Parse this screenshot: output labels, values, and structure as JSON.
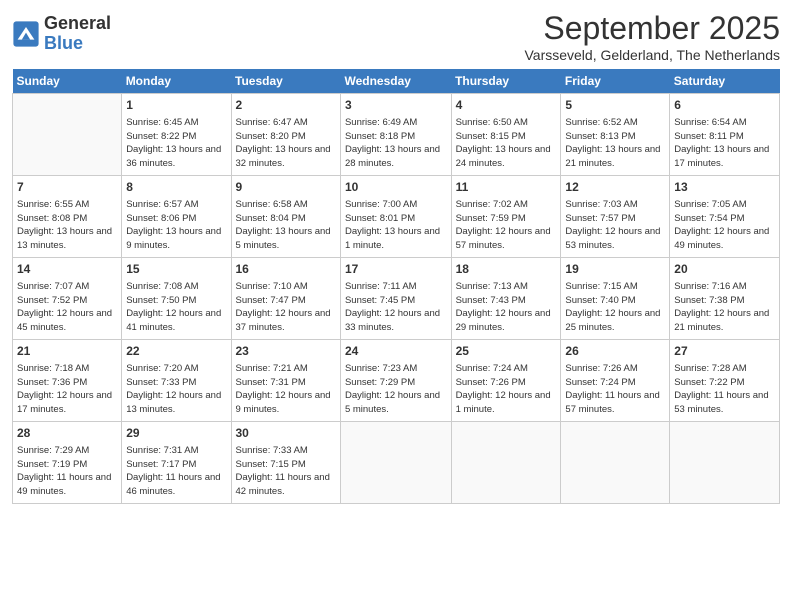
{
  "logo": {
    "general": "General",
    "blue": "Blue"
  },
  "title": "September 2025",
  "subtitle": "Varsseveld, Gelderland, The Netherlands",
  "days_header": [
    "Sunday",
    "Monday",
    "Tuesday",
    "Wednesday",
    "Thursday",
    "Friday",
    "Saturday"
  ],
  "weeks": [
    [
      {
        "day": "",
        "info": ""
      },
      {
        "day": "1",
        "info": "Sunrise: 6:45 AM\nSunset: 8:22 PM\nDaylight: 13 hours\nand 36 minutes."
      },
      {
        "day": "2",
        "info": "Sunrise: 6:47 AM\nSunset: 8:20 PM\nDaylight: 13 hours\nand 32 minutes."
      },
      {
        "day": "3",
        "info": "Sunrise: 6:49 AM\nSunset: 8:18 PM\nDaylight: 13 hours\nand 28 minutes."
      },
      {
        "day": "4",
        "info": "Sunrise: 6:50 AM\nSunset: 8:15 PM\nDaylight: 13 hours\nand 24 minutes."
      },
      {
        "day": "5",
        "info": "Sunrise: 6:52 AM\nSunset: 8:13 PM\nDaylight: 13 hours\nand 21 minutes."
      },
      {
        "day": "6",
        "info": "Sunrise: 6:54 AM\nSunset: 8:11 PM\nDaylight: 13 hours\nand 17 minutes."
      }
    ],
    [
      {
        "day": "7",
        "info": "Sunrise: 6:55 AM\nSunset: 8:08 PM\nDaylight: 13 hours\nand 13 minutes."
      },
      {
        "day": "8",
        "info": "Sunrise: 6:57 AM\nSunset: 8:06 PM\nDaylight: 13 hours\nand 9 minutes."
      },
      {
        "day": "9",
        "info": "Sunrise: 6:58 AM\nSunset: 8:04 PM\nDaylight: 13 hours\nand 5 minutes."
      },
      {
        "day": "10",
        "info": "Sunrise: 7:00 AM\nSunset: 8:01 PM\nDaylight: 13 hours\nand 1 minute."
      },
      {
        "day": "11",
        "info": "Sunrise: 7:02 AM\nSunset: 7:59 PM\nDaylight: 12 hours\nand 57 minutes."
      },
      {
        "day": "12",
        "info": "Sunrise: 7:03 AM\nSunset: 7:57 PM\nDaylight: 12 hours\nand 53 minutes."
      },
      {
        "day": "13",
        "info": "Sunrise: 7:05 AM\nSunset: 7:54 PM\nDaylight: 12 hours\nand 49 minutes."
      }
    ],
    [
      {
        "day": "14",
        "info": "Sunrise: 7:07 AM\nSunset: 7:52 PM\nDaylight: 12 hours\nand 45 minutes."
      },
      {
        "day": "15",
        "info": "Sunrise: 7:08 AM\nSunset: 7:50 PM\nDaylight: 12 hours\nand 41 minutes."
      },
      {
        "day": "16",
        "info": "Sunrise: 7:10 AM\nSunset: 7:47 PM\nDaylight: 12 hours\nand 37 minutes."
      },
      {
        "day": "17",
        "info": "Sunrise: 7:11 AM\nSunset: 7:45 PM\nDaylight: 12 hours\nand 33 minutes."
      },
      {
        "day": "18",
        "info": "Sunrise: 7:13 AM\nSunset: 7:43 PM\nDaylight: 12 hours\nand 29 minutes."
      },
      {
        "day": "19",
        "info": "Sunrise: 7:15 AM\nSunset: 7:40 PM\nDaylight: 12 hours\nand 25 minutes."
      },
      {
        "day": "20",
        "info": "Sunrise: 7:16 AM\nSunset: 7:38 PM\nDaylight: 12 hours\nand 21 minutes."
      }
    ],
    [
      {
        "day": "21",
        "info": "Sunrise: 7:18 AM\nSunset: 7:36 PM\nDaylight: 12 hours\nand 17 minutes."
      },
      {
        "day": "22",
        "info": "Sunrise: 7:20 AM\nSunset: 7:33 PM\nDaylight: 12 hours\nand 13 minutes."
      },
      {
        "day": "23",
        "info": "Sunrise: 7:21 AM\nSunset: 7:31 PM\nDaylight: 12 hours\nand 9 minutes."
      },
      {
        "day": "24",
        "info": "Sunrise: 7:23 AM\nSunset: 7:29 PM\nDaylight: 12 hours\nand 5 minutes."
      },
      {
        "day": "25",
        "info": "Sunrise: 7:24 AM\nSunset: 7:26 PM\nDaylight: 12 hours\nand 1 minute."
      },
      {
        "day": "26",
        "info": "Sunrise: 7:26 AM\nSunset: 7:24 PM\nDaylight: 11 hours\nand 57 minutes."
      },
      {
        "day": "27",
        "info": "Sunrise: 7:28 AM\nSunset: 7:22 PM\nDaylight: 11 hours\nand 53 minutes."
      }
    ],
    [
      {
        "day": "28",
        "info": "Sunrise: 7:29 AM\nSunset: 7:19 PM\nDaylight: 11 hours\nand 49 minutes."
      },
      {
        "day": "29",
        "info": "Sunrise: 7:31 AM\nSunset: 7:17 PM\nDaylight: 11 hours\nand 46 minutes."
      },
      {
        "day": "30",
        "info": "Sunrise: 7:33 AM\nSunset: 7:15 PM\nDaylight: 11 hours\nand 42 minutes."
      },
      {
        "day": "",
        "info": ""
      },
      {
        "day": "",
        "info": ""
      },
      {
        "day": "",
        "info": ""
      },
      {
        "day": "",
        "info": ""
      }
    ]
  ]
}
